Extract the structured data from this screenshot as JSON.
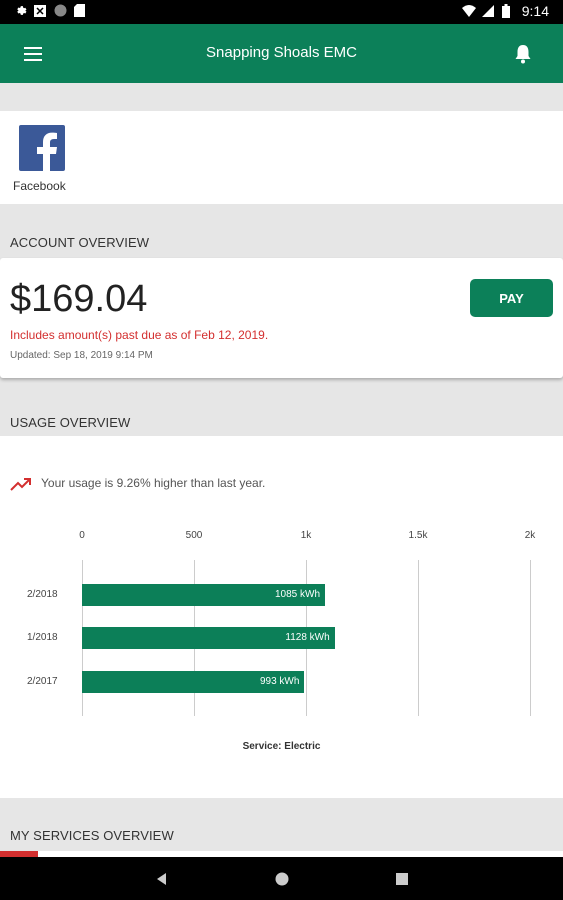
{
  "status_bar": {
    "time": "9:14"
  },
  "app_bar": {
    "title": "Snapping Shoals EMC"
  },
  "social": {
    "facebook_label": "Facebook"
  },
  "account": {
    "section_title": "ACCOUNT OVERVIEW",
    "amount": "$169.04",
    "past_due": "Includes amount(s) past due as of Feb 12, 2019.",
    "updated": "Updated:  Sep 18, 2019 9:14 PM",
    "pay_label": "PAY"
  },
  "usage": {
    "section_title": "USAGE OVERVIEW",
    "note": "Your usage is 9.26% higher than last year.",
    "caption": "Service: Electric"
  },
  "services": {
    "section_title": "MY SERVICES OVERVIEW"
  },
  "colors": {
    "brand_green": "#0c8059",
    "alert_red": "#d32f2f"
  },
  "chart_data": {
    "type": "bar",
    "orientation": "horizontal",
    "categories": [
      "2/2018",
      "1/2018",
      "2/2017"
    ],
    "values": [
      1085,
      1128,
      993
    ],
    "value_labels": [
      "1085 kWh",
      "1128 kWh",
      "993 kWh"
    ],
    "xlim": [
      0,
      2000
    ],
    "ticks": [
      0,
      500,
      1000,
      1500,
      2000
    ],
    "tick_labels": [
      "0",
      "500",
      "1k",
      "1.5k",
      "2k"
    ],
    "grid": true
  }
}
